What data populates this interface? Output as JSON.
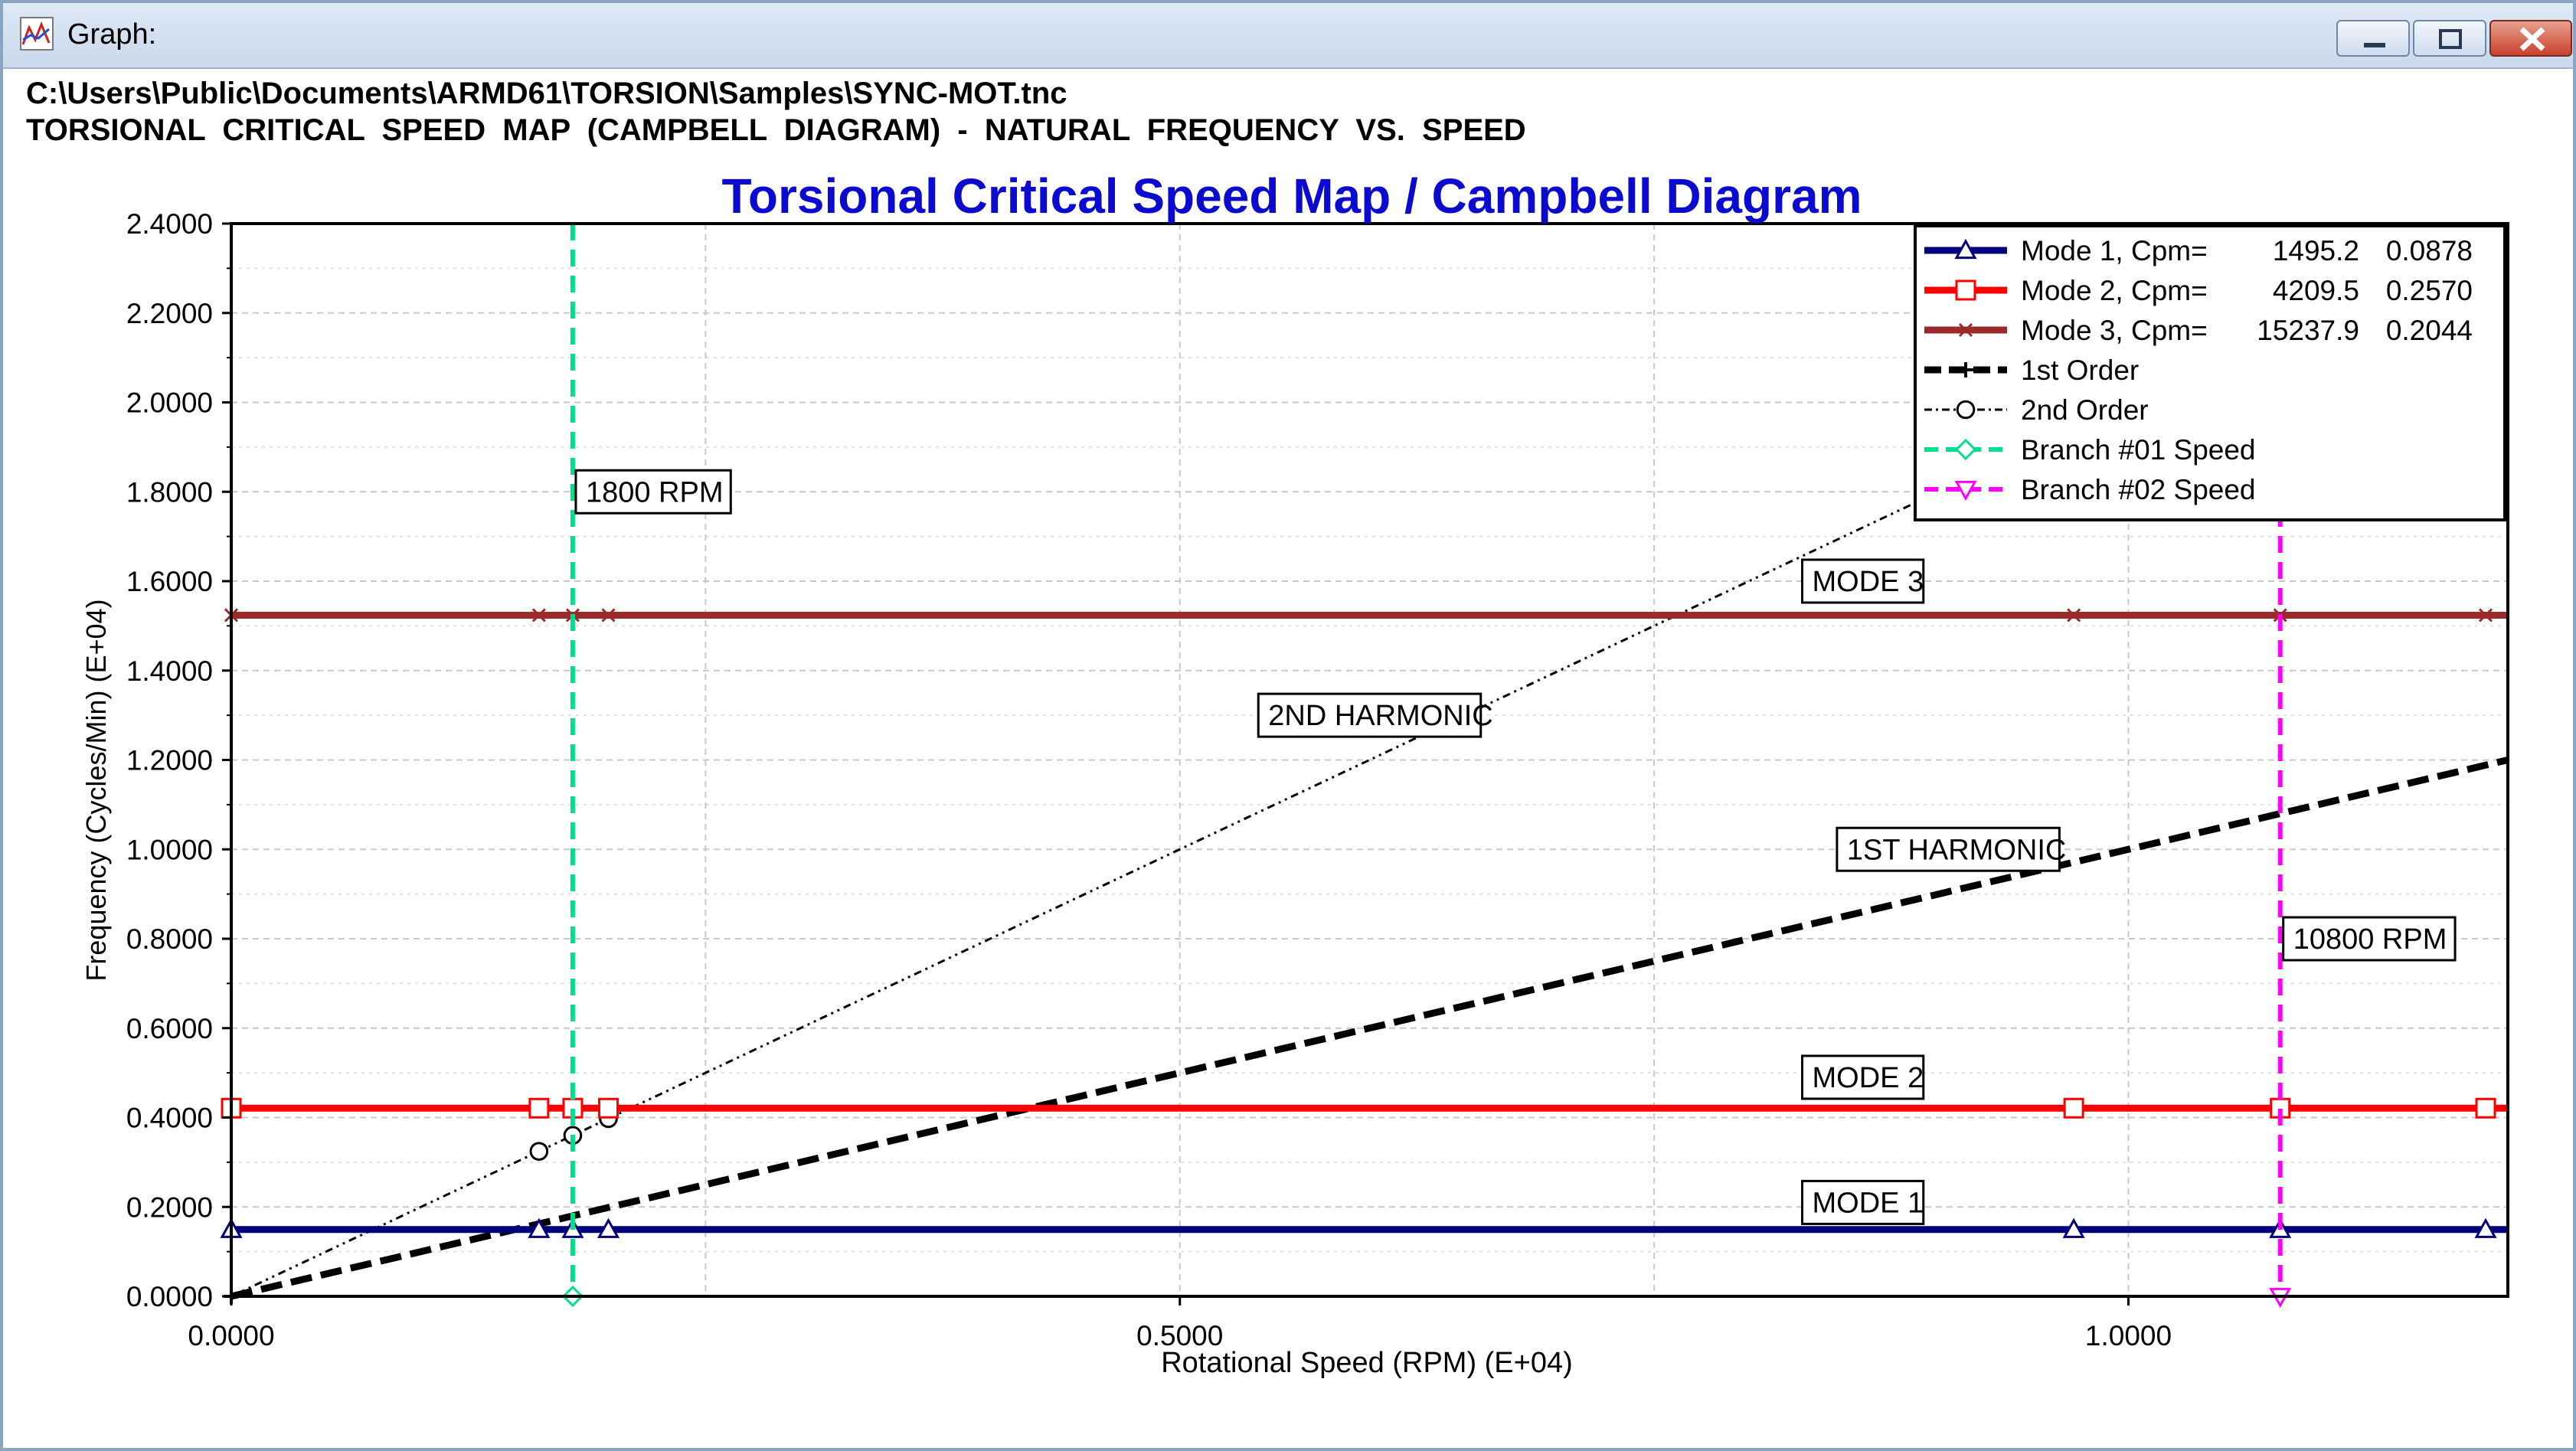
{
  "window": {
    "title": "Graph:",
    "file_path": "C:\\Users\\Public\\Documents\\ARMD61\\TORSION\\Samples\\SYNC-MOT.tnc",
    "subtitle": "TORSIONAL  CRITICAL  SPEED  MAP  (CAMPBELL  DIAGRAM)  -  NATURAL  FREQUENCY  VS.  SPEED",
    "buttons": [
      "minimize",
      "maximize",
      "close"
    ]
  },
  "colors": {
    "title_blue": "#0b0bd0",
    "mode1": "#00007a",
    "mode2": "#ff0000",
    "mode3": "#9b2a2a",
    "branch1": "#00e08a",
    "branch2": "#ff00ff",
    "harmonic": "#000000"
  },
  "chart_data": {
    "type": "line",
    "title": "Torsional Critical Speed Map / Campbell Diagram",
    "xlabel": "Rotational Speed (RPM) (E+04)",
    "ylabel": "Frequency (Cycles/Min) (E+04)",
    "xlim": [
      0,
      1.2
    ],
    "ylim": [
      0,
      2.4
    ],
    "xticks": [
      "0.0000",
      "0.5000",
      "1.0000"
    ],
    "yticks": [
      "0.0000",
      "0.2000",
      "0.4000",
      "0.6000",
      "0.8000",
      "1.0000",
      "1.2000",
      "1.4000",
      "1.6000",
      "1.8000",
      "2.0000",
      "2.2000",
      "2.4000"
    ],
    "grid": true,
    "legend_position": "top-right",
    "legend": [
      {
        "label": "Mode 1, Cpm=",
        "cpm": "1495.2",
        "ratio": "0.0878",
        "color": "#00007a",
        "marker": "triangle"
      },
      {
        "label": "Mode 2, Cpm=",
        "cpm": "4209.5",
        "ratio": "0.2570",
        "color": "#ff0000",
        "marker": "square"
      },
      {
        "label": "Mode 3, Cpm=",
        "cpm": "15237.9",
        "ratio": "0.2044",
        "color": "#9b2a2a",
        "marker": "x"
      },
      {
        "label": "1st Order",
        "color": "#000000",
        "marker": "plus"
      },
      {
        "label": "2nd Order",
        "color": "#000000",
        "marker": "circle"
      },
      {
        "label": "Branch #01 Speed",
        "color": "#00e08a",
        "marker": "diamond"
      },
      {
        "label": "Branch #02 Speed",
        "color": "#ff00ff",
        "marker": "inv-triangle"
      }
    ],
    "series": [
      {
        "name": "Mode 1",
        "kind": "horizontal",
        "y": 0.14952,
        "marker_x": [
          0,
          0.1622,
          0.18,
          0.1988,
          0.9712,
          1.08,
          1.1883
        ]
      },
      {
        "name": "Mode 2",
        "kind": "horizontal",
        "y": 0.42095,
        "marker_x": [
          0,
          0.1622,
          0.18,
          0.1988,
          0.9712,
          1.08,
          1.1883
        ]
      },
      {
        "name": "Mode 3",
        "kind": "horizontal",
        "y": 1.52379,
        "marker_x": [
          0,
          0.1622,
          0.18,
          0.1988,
          0.9712,
          1.08,
          1.1883
        ]
      },
      {
        "name": "1st Order",
        "kind": "line",
        "x": [
          0,
          1.2
        ],
        "y": [
          0,
          1.2
        ]
      },
      {
        "name": "2nd Order",
        "kind": "line",
        "x": [
          0,
          1.2
        ],
        "y": [
          0,
          2.4
        ],
        "marker_x": [
          0.1622,
          0.18,
          0.1988
        ]
      },
      {
        "name": "Branch #01 Speed",
        "kind": "vertical",
        "x": 0.18
      },
      {
        "name": "Branch #02 Speed",
        "kind": "vertical",
        "x": 1.08
      }
    ],
    "annotations": [
      {
        "text": "1800 RPM",
        "x": 0.18,
        "y": 1.8
      },
      {
        "text": "MODE 3",
        "x": 0.86,
        "y": 1.6
      },
      {
        "text": "2ND HARMONIC",
        "x": 0.6,
        "y": 1.3
      },
      {
        "text": "1ST HARMONIC",
        "x": 0.905,
        "y": 1.0
      },
      {
        "text": "10800 RPM",
        "x": 1.08,
        "y": 0.8
      },
      {
        "text": "MODE 2",
        "x": 0.86,
        "y": 0.49
      },
      {
        "text": "MODE 1",
        "x": 0.86,
        "y": 0.21
      }
    ]
  }
}
